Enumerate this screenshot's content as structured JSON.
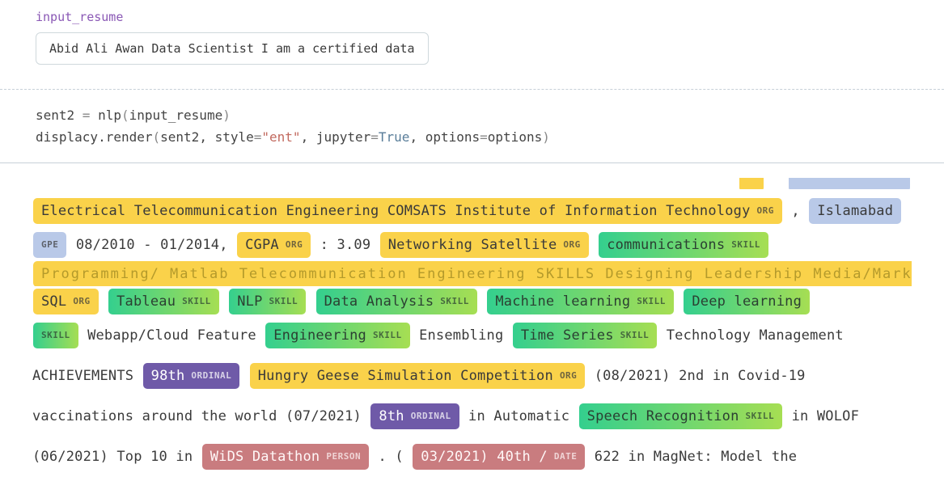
{
  "top": {
    "var_name": "input_resume",
    "input_value": "Abid Ali Awan Data Scientist I am a certified data"
  },
  "code": {
    "l1_a": "sent2 ",
    "l1_eq": "=",
    "l1_b": " nlp",
    "l1_paren_o": "(",
    "l1_arg": "input_resume",
    "l1_paren_c": ")",
    "l2_a": "displacy.render",
    "l2_paren_o": "(",
    "l2_arg1": "sent2",
    "l2_comma1": ", ",
    "l2_kw1": "style",
    "l2_eq1": "=",
    "l2_str": "\"ent\"",
    "l2_comma2": ", ",
    "l2_kw2": "jupyter",
    "l2_eq2": "=",
    "l2_bool": "True",
    "l2_comma3": ", ",
    "l2_kw3": "options",
    "l2_eq3": "=",
    "l2_arg3": "options",
    "l2_paren_c": ")"
  },
  "entity_labels": {
    "ORG": "ORG",
    "GPE": "GPE",
    "SKILL": "SKILL",
    "ORDINAL": "ORDINAL",
    "PERSON": "PERSON",
    "DATE": "DATE"
  },
  "ents": {
    "e_org_comsats": "Electrical Telecommunication Engineering COMSATS Institute of Information Technology",
    "t_comma1": ", ",
    "e_gpe_islamabad": "Islamabad",
    "e_gpe_pad": "GPE",
    "t_dates": " 08/2010 - 01/2014,  ",
    "e_org_cgpa": "CGPA",
    "t_cgpa_val": " : 3.09  ",
    "e_org_netsat": "Networking Satellite",
    "t_sp1": "  ",
    "e_skill_comm": "communications",
    "t_hidden_row": "Programming/ Matlab Telecommunication Engineering SKILLS Designing Leadership Media/Marketing R/Python",
    "e_org_sql": "SQL",
    "e_skill_tableau": "Tableau",
    "e_skill_nlp": "NLP",
    "e_skill_da": "Data Analysis",
    "e_skill_ml": "Machine learning",
    "e_skill_dl": "Deep learning",
    "e_skill_blank": "SKILL",
    "t_webapp": " Webapp/Cloud Feature  ",
    "e_skill_eng": "Engineering",
    "t_ensembling": " Ensembling  ",
    "e_skill_ts": "Time Series",
    "t_techmgmt": " Technology Management",
    "t_achievements": "ACHIEVEMENTS  ",
    "e_ord_98": "98th",
    "e_org_hungry": "Hungry Geese Simulation Competition",
    "t_covid": " (08/2021) 2nd in Covid-19",
    "t_vacc": "vaccinations around the world (07/2021)  ",
    "e_ord_8": "8th",
    "t_inauto": " in Automatic  ",
    "e_skill_asr": "Speech Recognition",
    "t_inwolof": " in WOLOF",
    "t_top10": "(06/2021) Top 10 in  ",
    "e_person_wids": "WiDS Datathon",
    "t_dotparen": " .  (  ",
    "e_date_mar": "03/2021) 40th /",
    "t_magnet": " 622 in MagNet: Model the"
  }
}
